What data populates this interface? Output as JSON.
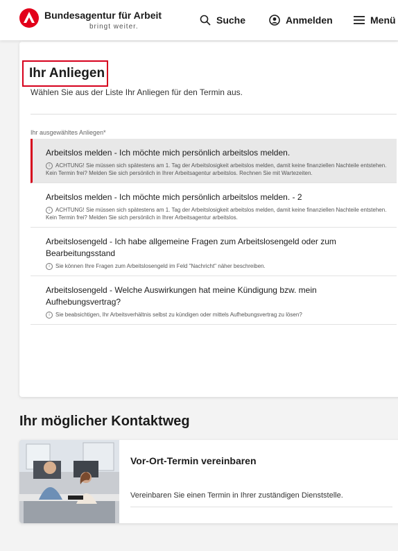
{
  "header": {
    "brand_name": "Bundesagentur für Arbeit",
    "brand_tagline": "bringt weiter.",
    "nav": {
      "search_label": "Suche",
      "login_label": "Anmelden",
      "menu_label": "Menü"
    },
    "colors": {
      "brand_red": "#e2001a"
    }
  },
  "anliegen": {
    "title": "Ihr Anliegen",
    "intro": "Wählen Sie aus der Liste Ihr Anliegen für den Termin aus.",
    "list_label": "Ihr ausgewähltes Anliegen*",
    "options": [
      {
        "title": "Arbeitslos melden - Ich möchte mich persönlich arbeitslos melden.",
        "note": "ACHTUNG! Sie müssen sich spätestens am 1. Tag der Arbeitslosigkeit arbeitslos melden, damit keine finanziellen Nachteile entstehen. Kein Termin frei? Melden Sie sich persönlich in Ihrer Arbeitsagentur arbeitslos. Rechnen Sie mit Wartezeiten.",
        "selected": true
      },
      {
        "title": "Arbeitslos melden - Ich möchte mich persönlich arbeitslos melden. - 2",
        "note": "ACHTUNG! Sie müssen sich spätestens am 1. Tag der Arbeitslosigkeit arbeitslos melden, damit keine finanziellen Nachteile entstehen. Kein Termin frei? Melden Sie sich persönlich in Ihrer Arbeitsagentur arbeitslos.",
        "selected": false
      },
      {
        "title": "Arbeitslosengeld - Ich habe allgemeine Fragen zum Arbeitslosengeld oder zum Bearbeitungsstand",
        "note": "Sie können Ihre Fragen zum Arbeitslosengeld im Feld \"Nachricht\" näher beschreiben.",
        "selected": false
      },
      {
        "title": "Arbeitslosengeld - Welche Auswirkungen hat meine Kündigung bzw. mein Aufhebungsvertrag?",
        "note": "Sie beabsichtigen, Ihr Arbeitsverhältnis selbst zu kündigen oder mittels Aufhebungsvertrag zu lösen?",
        "selected": false
      }
    ]
  },
  "contact": {
    "heading": "Ihr möglicher Kontaktweg",
    "option_title": "Vor-Ort-Termin vereinbaren",
    "option_desc": "Vereinbaren Sie einen Termin in Ihrer zuständigen Dienststelle."
  }
}
